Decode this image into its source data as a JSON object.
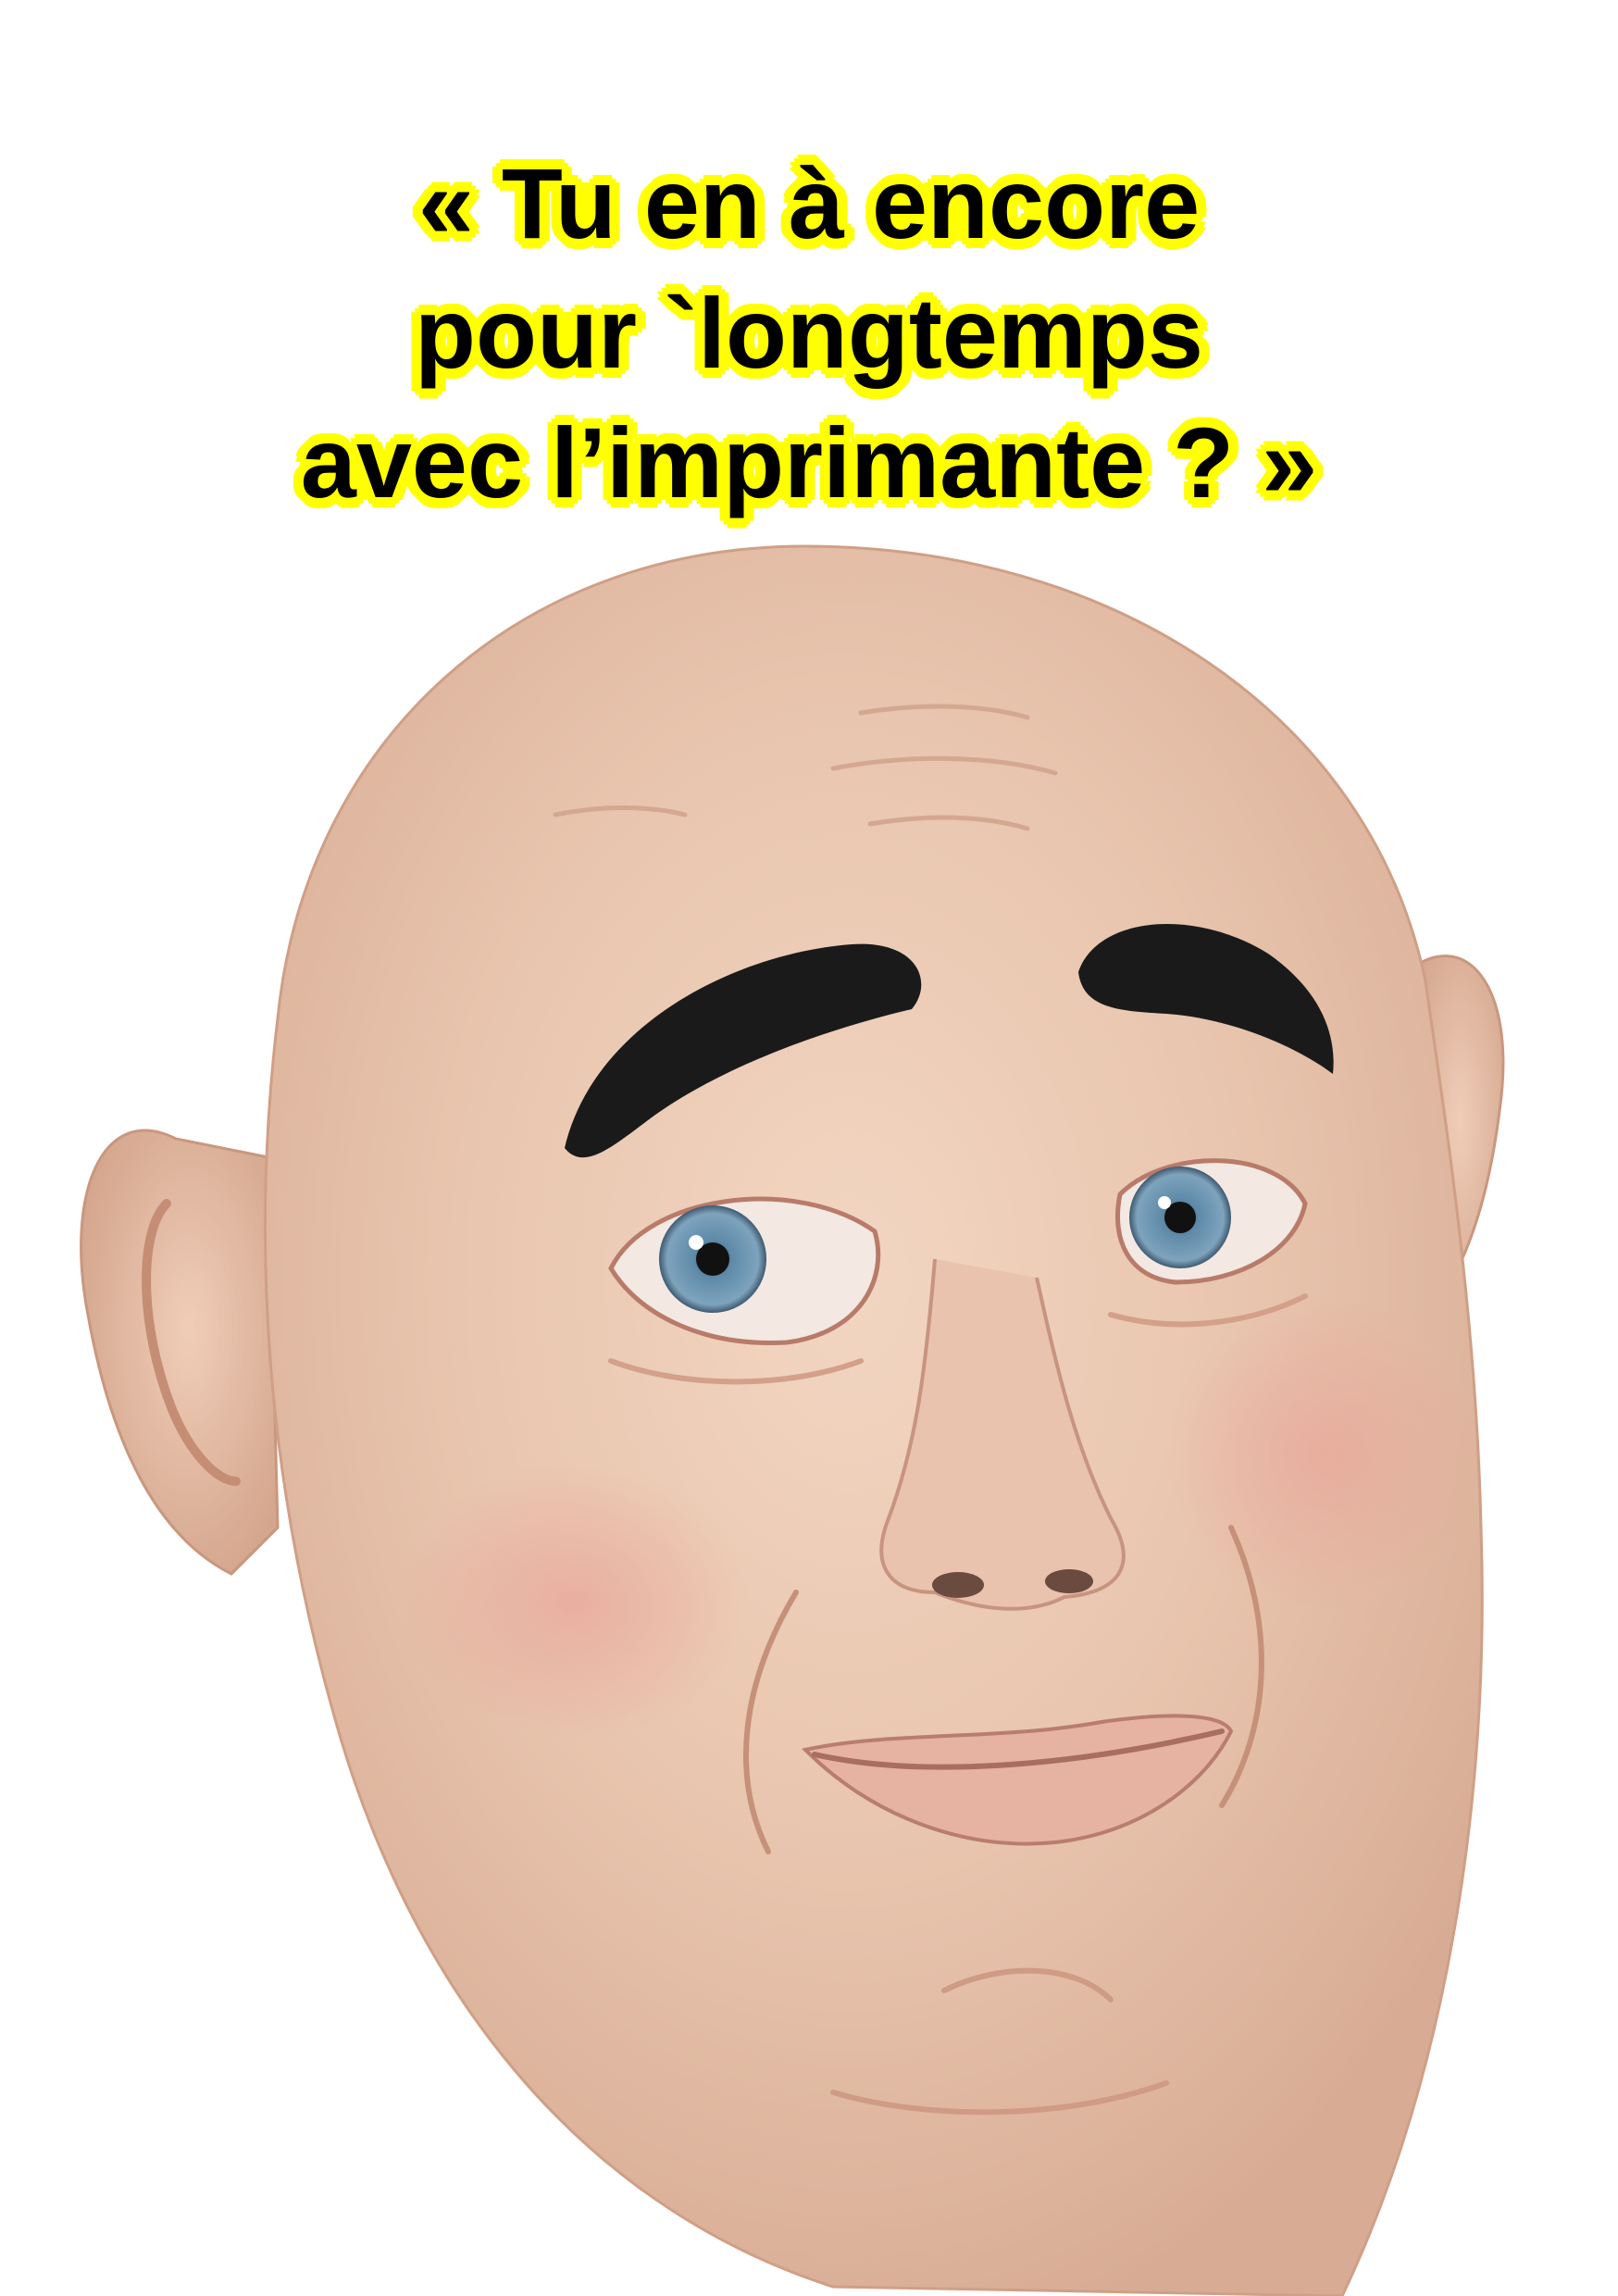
{
  "caption": {
    "lines": [
      "« Tu en à encore",
      "pour `longtemps",
      "avec l’imprimante ? »"
    ],
    "text_color": "#000000",
    "highlight_color": "#ffff00"
  },
  "illustration": {
    "subject": "bald-latex-mask-face",
    "skin_color": "#e8c7b0",
    "eyebrow_color": "#1a1a1a",
    "iris_color": "#5e8aa8",
    "background_color": "#ffffff"
  }
}
